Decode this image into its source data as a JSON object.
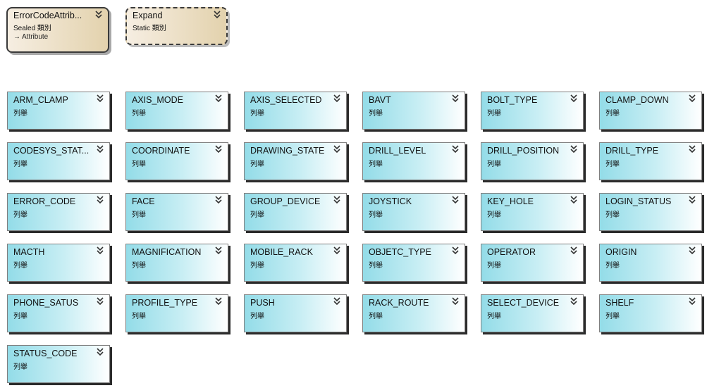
{
  "class_boxes": [
    {
      "name": "ErrorCodeAttrib...",
      "stereotype": "Sealed 類別",
      "parent": "Attribute",
      "parent_arrow": "→"
    },
    {
      "name": "Expand",
      "stereotype": "Static 類別"
    }
  ],
  "enums": [
    {
      "name": "ARM_CLAMP",
      "stereotype": "列舉"
    },
    {
      "name": "AXIS_MODE",
      "stereotype": "列舉"
    },
    {
      "name": "AXIS_SELECTED",
      "stereotype": "列舉"
    },
    {
      "name": "BAVT",
      "stereotype": "列舉"
    },
    {
      "name": "BOLT_TYPE",
      "stereotype": "列舉"
    },
    {
      "name": "CLAMP_DOWN",
      "stereotype": "列舉"
    },
    {
      "name": "CODESYS_STAT...",
      "stereotype": "列舉"
    },
    {
      "name": "COORDINATE",
      "stereotype": "列舉"
    },
    {
      "name": "DRAWING_STATE",
      "stereotype": "列舉"
    },
    {
      "name": "DRILL_LEVEL",
      "stereotype": "列舉"
    },
    {
      "name": "DRILL_POSITION",
      "stereotype": "列舉"
    },
    {
      "name": "DRILL_TYPE",
      "stereotype": "列舉"
    },
    {
      "name": "ERROR_CODE",
      "stereotype": "列舉"
    },
    {
      "name": "FACE",
      "stereotype": "列舉"
    },
    {
      "name": "GROUP_DEVICE",
      "stereotype": "列舉"
    },
    {
      "name": "JOYSTICK",
      "stereotype": "列舉"
    },
    {
      "name": "KEY_HOLE",
      "stereotype": "列舉"
    },
    {
      "name": "LOGIN_STATUS",
      "stereotype": "列舉"
    },
    {
      "name": "MACTH",
      "stereotype": "列舉"
    },
    {
      "name": "MAGNIFICATION",
      "stereotype": "列舉"
    },
    {
      "name": "MOBILE_RACK",
      "stereotype": "列舉"
    },
    {
      "name": "OBJETC_TYPE",
      "stereotype": "列舉"
    },
    {
      "name": "OPERATOR",
      "stereotype": "列舉"
    },
    {
      "name": "ORIGIN",
      "stereotype": "列舉"
    },
    {
      "name": "PHONE_SATUS",
      "stereotype": "列舉"
    },
    {
      "name": "PROFILE_TYPE",
      "stereotype": "列舉"
    },
    {
      "name": "PUSH",
      "stereotype": "列舉"
    },
    {
      "name": "RACK_ROUTE",
      "stereotype": "列舉"
    },
    {
      "name": "SELECT_DEVICE",
      "stereotype": "列舉"
    },
    {
      "name": "SHELF",
      "stereotype": "列舉"
    },
    {
      "name": "STATUS_CODE",
      "stereotype": "列舉"
    }
  ],
  "icons": {
    "collapse": "double-chevron-down-icon"
  }
}
